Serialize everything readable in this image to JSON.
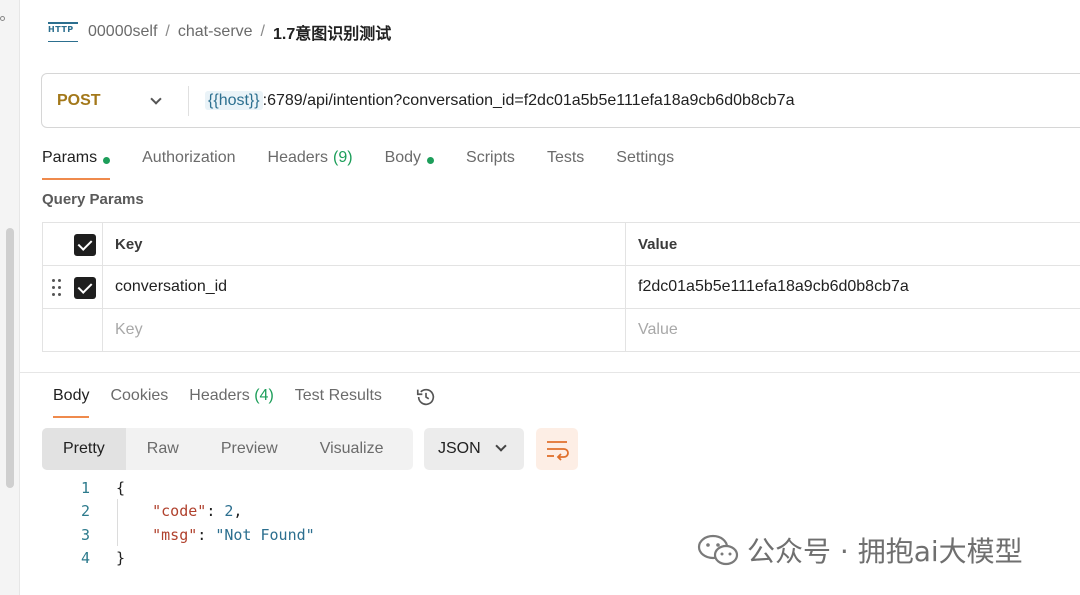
{
  "breadcrumb": {
    "icon": "http-icon",
    "items": [
      "00000self",
      "chat-serve",
      "1.7意图识别测试"
    ],
    "separator": "/"
  },
  "request": {
    "method": "POST",
    "url_variable": "{{host}}",
    "url_rest": ":6789/api/intention?conversation_id=f2dc01a5b5e111efa18a9cb6d0b8cb7a"
  },
  "request_tabs": {
    "params": "Params",
    "authorization": "Authorization",
    "headers": "Headers",
    "headers_count": "(9)",
    "body": "Body",
    "scripts": "Scripts",
    "tests": "Tests",
    "settings": "Settings"
  },
  "query_params": {
    "title": "Query Params",
    "columns": {
      "key": "Key",
      "value": "Value"
    },
    "rows": [
      {
        "key": "conversation_id",
        "value": "f2dc01a5b5e111efa18a9cb6d0b8cb7a",
        "checked": true
      }
    ],
    "placeholder_key": "Key",
    "placeholder_value": "Value"
  },
  "response_tabs": {
    "body": "Body",
    "cookies": "Cookies",
    "headers": "Headers",
    "headers_count": "(4)",
    "test_results": "Test Results"
  },
  "format": {
    "pretty": "Pretty",
    "raw": "Raw",
    "preview": "Preview",
    "visualize": "Visualize",
    "language": "JSON"
  },
  "code": {
    "line_numbers": [
      "1",
      "2",
      "3",
      "4"
    ],
    "open_brace": "{",
    "close_brace": "}",
    "code_key": "\"code\"",
    "code_value": "2",
    "msg_key": "\"msg\"",
    "msg_value": "\"Not Found\""
  },
  "watermark": "公众号 · 拥抱ai大模型",
  "colors": {
    "accent": "#ef8a4c",
    "method": "#a3781a",
    "green": "#1d9e5a",
    "variable": "#2c6f8f"
  }
}
